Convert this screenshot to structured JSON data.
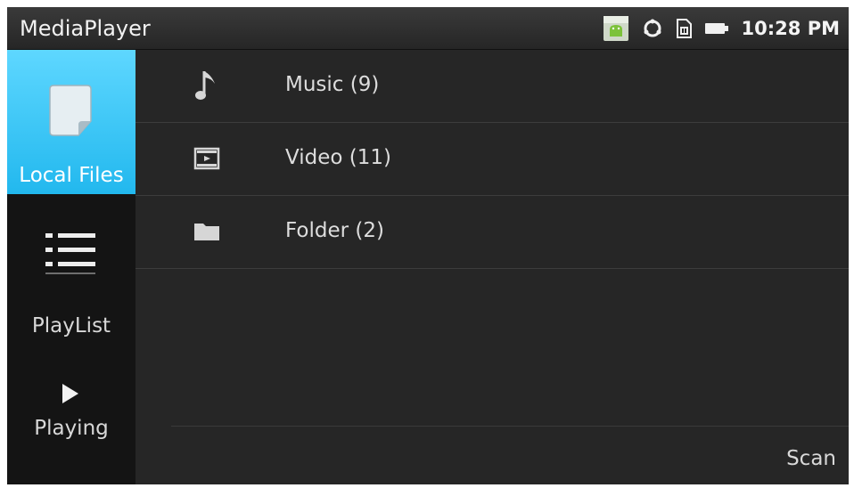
{
  "app": {
    "title": "MediaPlayer"
  },
  "status_bar": {
    "time": "10:28 PM",
    "icons": [
      "android-app-notification-icon",
      "sync-icon",
      "sim-card-icon",
      "battery-icon"
    ]
  },
  "sidebar": {
    "items": [
      {
        "label": "Local Files",
        "icon": "document-icon",
        "selected": true
      },
      {
        "label": "PlayList",
        "icon": "list-icon",
        "selected": false
      },
      {
        "label": "Playing",
        "icon": "play-icon",
        "selected": false
      }
    ]
  },
  "main": {
    "rows": [
      {
        "label": "Music  (9)",
        "icon": "music-note-icon"
      },
      {
        "label": "Video  (11)",
        "icon": "film-icon"
      },
      {
        "label": "Folder  (2)",
        "icon": "folder-icon"
      }
    ],
    "scan_label": "Scan"
  },
  "colors": {
    "accent": "#29bdf0",
    "background": "#262626",
    "sidebar": "#141414"
  }
}
